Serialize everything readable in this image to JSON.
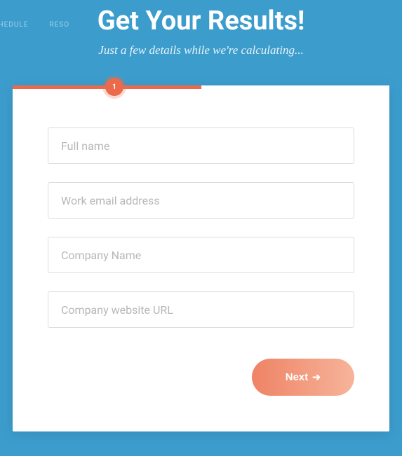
{
  "bgNav": {
    "item1": "CHEDULE",
    "item2": "RESO"
  },
  "header": {
    "title": "Get Your Results!",
    "subtitle": "Just a few details while we're calculating..."
  },
  "progress": {
    "step": "1"
  },
  "form": {
    "fullName": {
      "placeholder": "Full name",
      "value": ""
    },
    "email": {
      "placeholder": "Work email address",
      "value": ""
    },
    "company": {
      "placeholder": "Company Name",
      "value": ""
    },
    "website": {
      "placeholder": "Company website URL",
      "value": ""
    }
  },
  "actions": {
    "next": "Next"
  }
}
